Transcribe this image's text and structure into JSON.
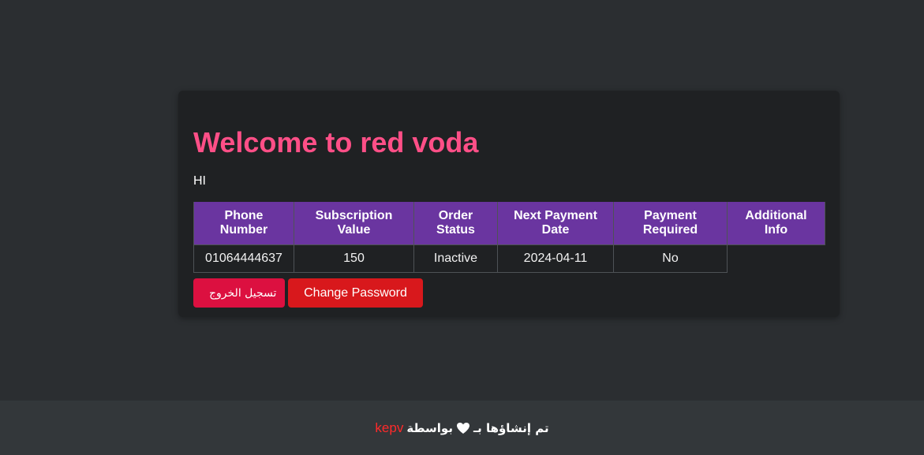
{
  "card": {
    "title": "Welcome to red voda",
    "greeting": "HI"
  },
  "table": {
    "headers": [
      {
        "line1": "Phone",
        "line2": "Number"
      },
      {
        "line1": "Subscription",
        "line2": "Value"
      },
      {
        "line1": "Order",
        "line2": "Status"
      },
      {
        "line1": "Next Payment",
        "line2": "Date"
      },
      {
        "line1": "Payment",
        "line2": "Required"
      },
      {
        "line1": "Additional",
        "line2": "Info"
      }
    ],
    "rows": [
      {
        "phone": "01064444637",
        "subscription_value": "150",
        "order_status": "Inactive",
        "next_payment_date": "2024-04-11",
        "payment_required": "No",
        "additional_info": ""
      }
    ]
  },
  "buttons": {
    "logout_label": "تسجيل الخروج",
    "change_password_label": "Change Password"
  },
  "footer": {
    "prefix": "تم إنشاؤها بـ",
    "heart_icon": "heart-icon",
    "by": "بواسطة",
    "brand": "kepv"
  },
  "colors": {
    "background": "#2b2e31",
    "card": "#1f2123",
    "title": "#ff4f87",
    "table_header": "#6a35a0",
    "logout_button": "#dc1040",
    "change_password_button": "#d8181c",
    "footer": "#33373a",
    "brand": "#ff2a2a"
  }
}
